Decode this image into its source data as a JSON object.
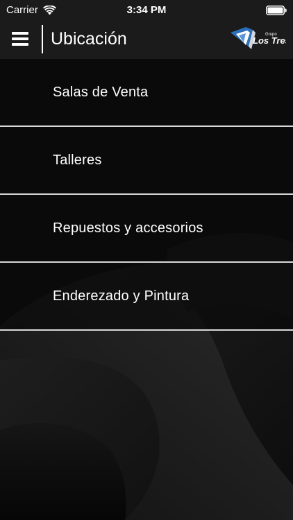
{
  "status_bar": {
    "carrier": "Carrier",
    "time": "3:34 PM",
    "wifi_icon": "wifi-icon",
    "battery_icon": "battery-icon"
  },
  "header": {
    "menu_icon": "hamburger-menu-icon",
    "title": "Ubicación",
    "logo": {
      "small_text": "Grupo",
      "name": "Los Tres"
    }
  },
  "menu": {
    "items": [
      {
        "label": "Salas de Venta"
      },
      {
        "label": "Talleres"
      },
      {
        "label": "Repuestos y accesorios"
      },
      {
        "label": "Enderezado y Pintura"
      }
    ]
  },
  "colors": {
    "bar_background": "#1b1b1b",
    "page_background": "#0b0b0b",
    "divider": "#d9d9d9",
    "logo_blue": "#2a6fb8",
    "text": "#ffffff"
  }
}
